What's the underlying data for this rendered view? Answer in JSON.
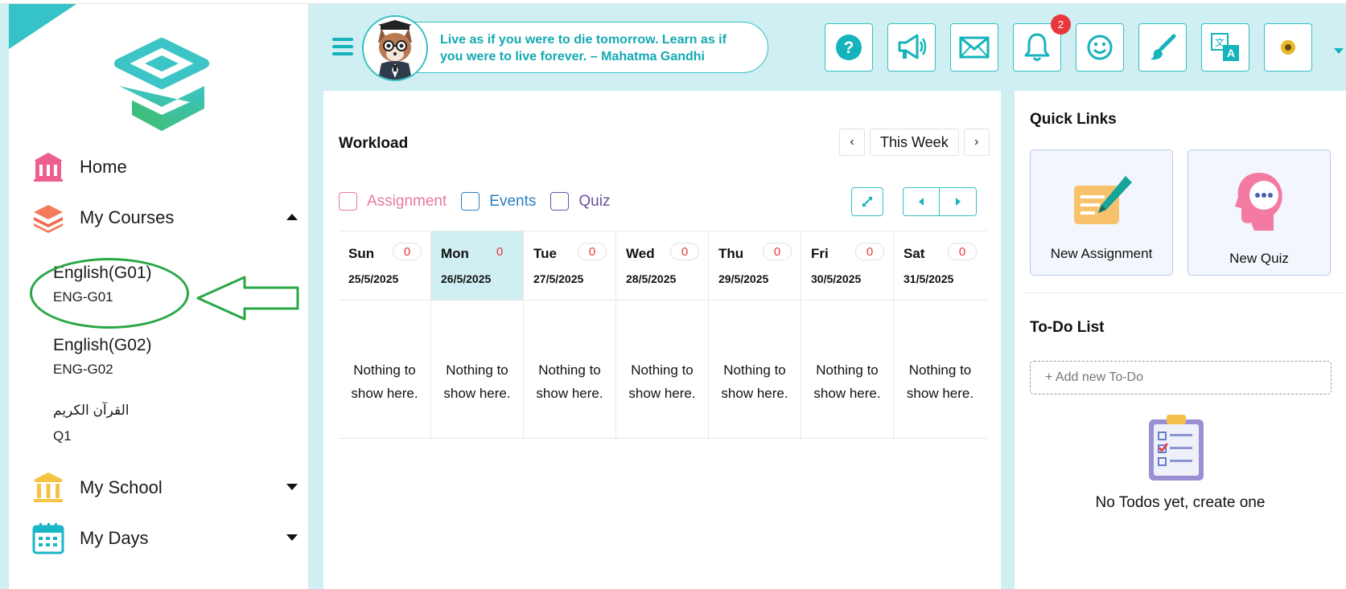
{
  "sidebar": {
    "nav": {
      "home": "Home",
      "my_courses": "My Courses",
      "my_school": "My School",
      "my_days": "My Days"
    },
    "courses": [
      {
        "name": "English(G01)",
        "code": "ENG-G01"
      },
      {
        "name": "English(G02)",
        "code": "ENG-G02"
      },
      {
        "name": "القرآن الكريم",
        "code": "Q1"
      }
    ]
  },
  "header": {
    "quote": "Live as if you were to die tomorrow. Learn as if you were to live forever. – Mahatma Gandhi",
    "notification_count": "2",
    "icons": [
      "help-icon",
      "megaphone-icon",
      "mail-icon",
      "bell-icon",
      "smiley-icon",
      "paintbrush-icon",
      "translate-icon",
      "profile-icon"
    ]
  },
  "workload": {
    "title": "Workload",
    "week_label": "This Week",
    "prev": "‹",
    "next": "›",
    "filters": [
      {
        "label": "Assignment",
        "color": "#e87aa0"
      },
      {
        "label": "Events",
        "color": "#2a7fc1"
      },
      {
        "label": "Quiz",
        "color": "#6b4fa0"
      }
    ],
    "days": [
      {
        "name": "Sun",
        "count": "0",
        "date": "25/5/2025",
        "empty_1": "Nothing to",
        "empty_2": "show here."
      },
      {
        "name": "Mon",
        "count": "0",
        "date": "26/5/2025",
        "empty_1": "Nothing to",
        "empty_2": "show here."
      },
      {
        "name": "Tue",
        "count": "0",
        "date": "27/5/2025",
        "empty_1": "Nothing to",
        "empty_2": "show here."
      },
      {
        "name": "Wed",
        "count": "0",
        "date": "28/5/2025",
        "empty_1": "Nothing to",
        "empty_2": "show here."
      },
      {
        "name": "Thu",
        "count": "0",
        "date": "29/5/2025",
        "empty_1": "Nothing to",
        "empty_2": "show here."
      },
      {
        "name": "Fri",
        "count": "0",
        "date": "30/5/2025",
        "empty_1": "Nothing to",
        "empty_2": "show here."
      },
      {
        "name": "Sat",
        "count": "0",
        "date": "31/5/2025",
        "empty_1": "Nothing to",
        "empty_2": "show here."
      }
    ]
  },
  "quick_links": {
    "title": "Quick Links",
    "items": [
      "New Assignment",
      "New Quiz"
    ]
  },
  "todo": {
    "title": "To-Do List",
    "placeholder": "+ Add new To-Do",
    "empty_message": "No Todos yet, create one"
  },
  "colors": {
    "accent": "#15b3bb",
    "background": "#cfeff2",
    "badge": "#e8383d"
  }
}
